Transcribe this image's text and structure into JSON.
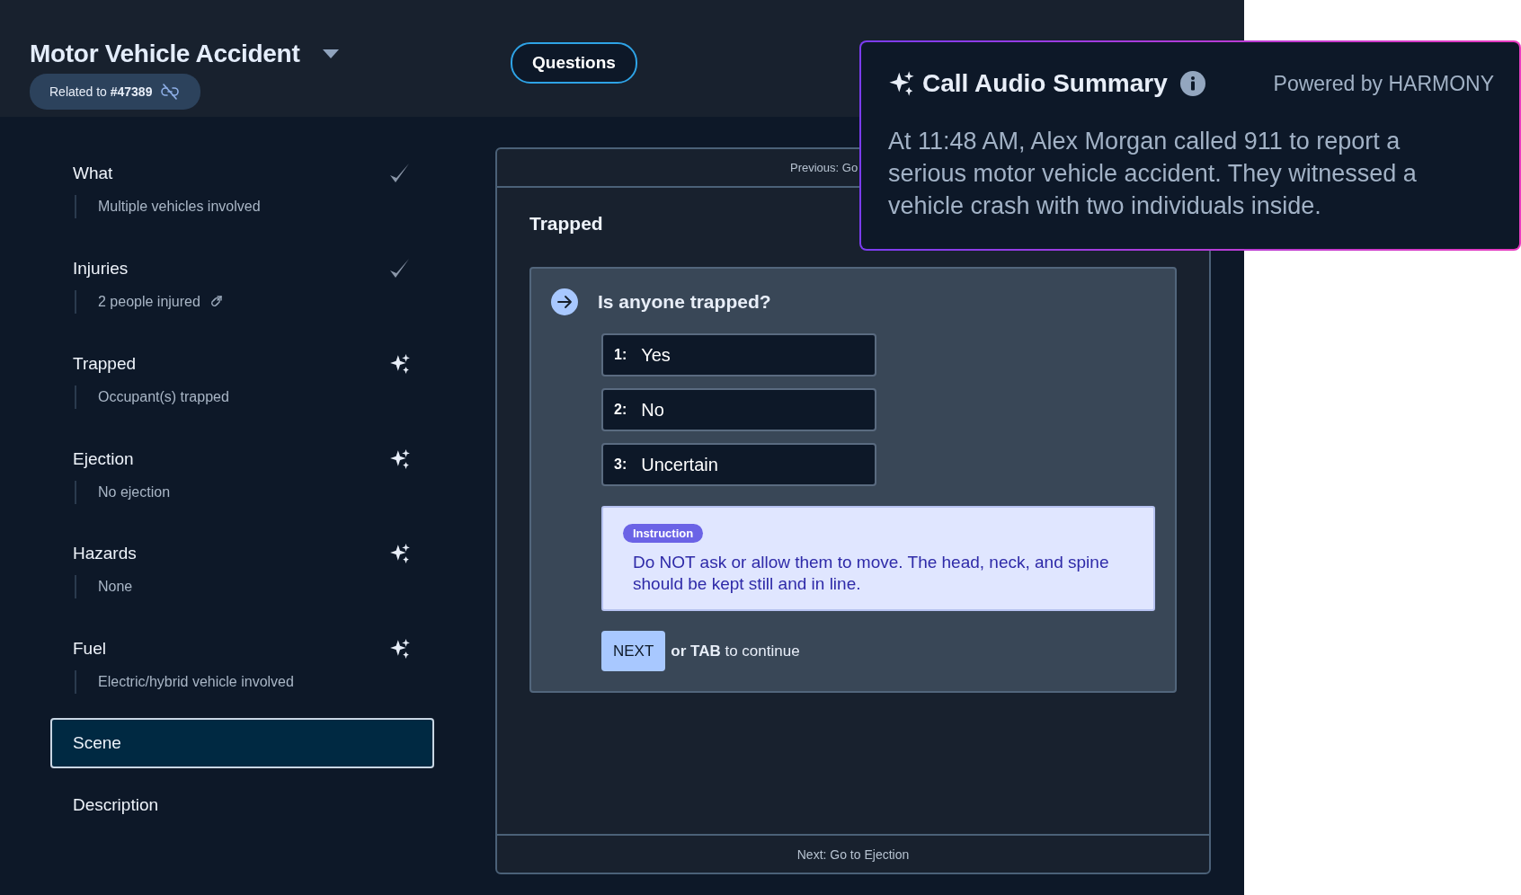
{
  "header": {
    "title": "Motor Vehicle Accident",
    "related": "Related to **#47389**",
    "questions_button": "Questions"
  },
  "sidebar": {
    "items": [
      {
        "label": "What",
        "summary": "Multiple vehicles involved",
        "kind": "done",
        "linked": false,
        "selected": false
      },
      {
        "label": "Injuries",
        "summary": "2 people injured",
        "kind": "done",
        "linked": true,
        "selected": false
      },
      {
        "label": "Trapped",
        "summary": "Occupant(s) trapped",
        "kind": "suggested",
        "linked": false,
        "selected": false
      },
      {
        "label": "Ejection",
        "summary": "No ejection",
        "kind": "suggested",
        "linked": false,
        "selected": false
      },
      {
        "label": "Hazards",
        "summary": "None",
        "kind": "suggested",
        "linked": false,
        "selected": false
      },
      {
        "label": "Fuel",
        "summary": "Electric/hybrid vehicle involved",
        "kind": "suggested",
        "linked": false,
        "selected": false
      },
      {
        "label": "Scene",
        "kind": "section",
        "selected": true
      },
      {
        "label": "Description",
        "kind": "section",
        "selected": false
      }
    ]
  },
  "main": {
    "previous": "Previous: Go",
    "section_title": "Trapped",
    "question": "Is anyone trapped?",
    "options": [
      {
        "key": "1:",
        "label": "Yes",
        "selected": false
      },
      {
        "key": "2:",
        "label": "No",
        "selected": false
      },
      {
        "key": "3:",
        "label": "Uncertain",
        "selected": false
      }
    ],
    "instruction": {
      "badge": "Instruction",
      "text": "Do NOT ask or allow them to move. The head, neck, and spine should be kept still and in line."
    },
    "next_button": "NEXT",
    "next_hint": "**or TAB** to continue",
    "next_link": "Next: Go to Ejection"
  },
  "summary_popup": {
    "title": "Call Audio Summary",
    "powered_by": "Powered by HARMONY",
    "text": "At 11:48 AM, Alex Morgan called 911 to report a serious motor vehicle accident. They witnessed a vehicle crash with two individuals inside."
  }
}
